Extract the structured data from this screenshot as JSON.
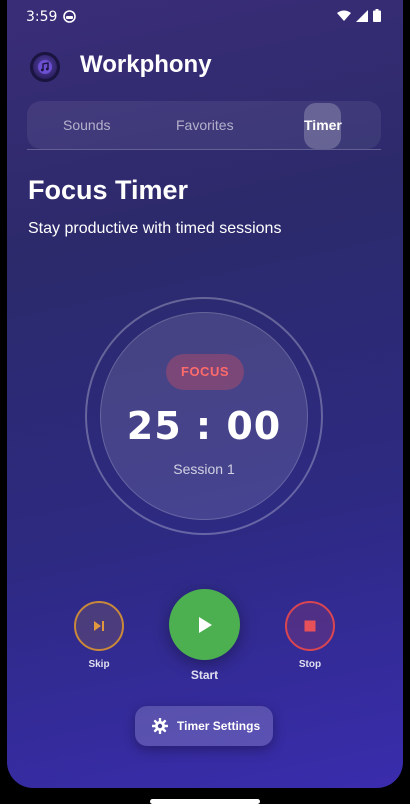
{
  "status_bar": {
    "time": "3:59"
  },
  "header": {
    "app_title": "Workphony",
    "logo_icon": "music-note-icon"
  },
  "tabs": [
    {
      "label": "Sounds",
      "active": false
    },
    {
      "label": "Favorites",
      "active": false
    },
    {
      "label": "Timer",
      "active": true
    }
  ],
  "page": {
    "title": "Focus Timer",
    "subtitle": "Stay productive with timed sessions"
  },
  "timer": {
    "mode": "FOCUS",
    "display": "25 : 00",
    "session": "Session 1"
  },
  "controls": {
    "skip_label": "Skip",
    "start_label": "Start",
    "stop_label": "Stop",
    "skip_color": "#c9883a",
    "start_color": "#4caf50",
    "stop_color": "#d94652"
  },
  "settings_button": {
    "label": "Timer Settings",
    "icon": "gear-icon"
  },
  "colors": {
    "focus_badge_text": "#ff6b6b",
    "background_top": "#3a2d78",
    "background_bottom": "#3a2cad"
  }
}
